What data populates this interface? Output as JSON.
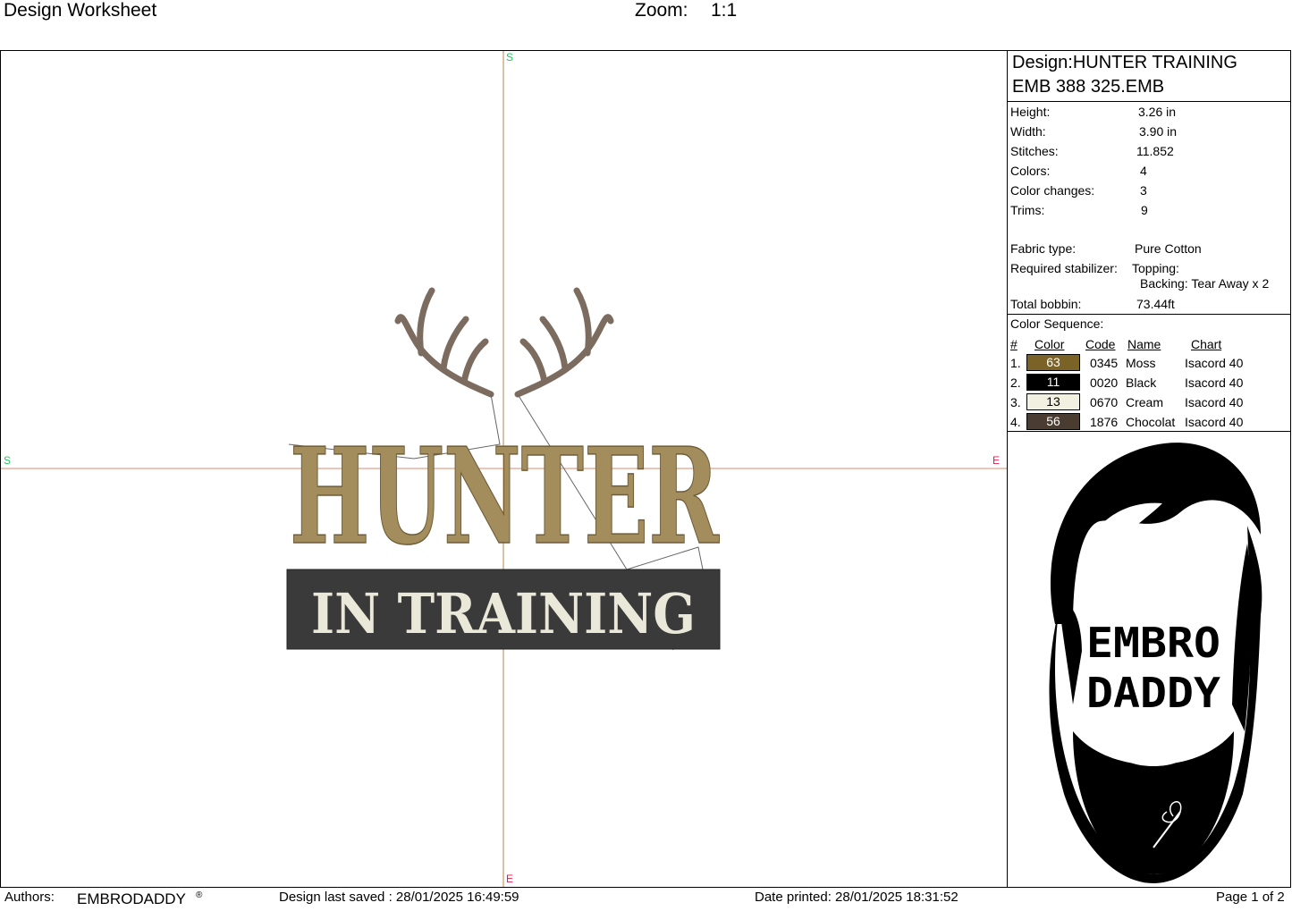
{
  "header": {
    "title": "Design Worksheet",
    "zoom_label": "Zoom:",
    "zoom_value": "1:1"
  },
  "canvas": {
    "axis_marks": {
      "top": "S",
      "bottom": "E",
      "left": "S",
      "right": "E"
    },
    "design_text": {
      "line1": "HUNTER",
      "line2": "IN TRAINING"
    },
    "colors": {
      "axis": "#b8864a",
      "marker_green": "#22c55e",
      "marker_red": "#e11d48",
      "moss": "#a38d5d",
      "antler": "#7c6c60",
      "black": "#3a3a3a",
      "cream": "#eae8d8"
    }
  },
  "info": {
    "design_name": "Design:HUNTER TRAINING",
    "file_name": "EMB 388 325.EMB",
    "rows": [
      {
        "label": "Height:",
        "value": "3.26 in"
      },
      {
        "label": "Width:",
        "value": "3.90 in"
      },
      {
        "label": "Stitches:",
        "value": "11.852"
      },
      {
        "label": "Colors:",
        "value": "4"
      },
      {
        "label": "Color changes:",
        "value": "3"
      },
      {
        "label": "Trims:",
        "value": "9"
      }
    ],
    "fabric_label": "Fabric type:",
    "fabric_value": "Pure Cotton",
    "stabilizer_label": "Required stabilizer:",
    "topping": "Topping:",
    "backing": "Backing: Tear Away x 2",
    "bobbin_label": "Total bobbin:",
    "bobbin_value": "73.44ft",
    "sequence_title": "Color Sequence:",
    "sequence_headers": {
      "num": "#",
      "color": "Color",
      "code": "Code",
      "name": "Name",
      "chart": "Chart"
    },
    "sequence": [
      {
        "num": "1.",
        "color_no": "63",
        "swatch": "#7b6328",
        "text_color": "#ffffff",
        "code": "0345",
        "name": "Moss",
        "chart": "Isacord 40"
      },
      {
        "num": "2.",
        "color_no": "11",
        "swatch": "#000000",
        "text_color": "#ffffff",
        "code": "0020",
        "name": "Black",
        "chart": "Isacord 40"
      },
      {
        "num": "3.",
        "color_no": "13",
        "swatch": "#f2f0e0",
        "text_color": "#000000",
        "code": "0670",
        "name": "Cream",
        "chart": "Isacord 40"
      },
      {
        "num": "4.",
        "color_no": "56",
        "swatch": "#4a3c31",
        "text_color": "#ffffff",
        "code": "1876",
        "name": "Chocolat",
        "chart": "Isacord 40"
      }
    ]
  },
  "logo": {
    "line1": "EMBRO",
    "line2": "DADDY"
  },
  "footer": {
    "authors_label": "Authors:",
    "authors_value": "EMBRODADDY",
    "registered": "®",
    "saved": "Design last saved : 28/01/2025 16:49:59",
    "printed": "Date printed: 28/01/2025 18:31:52",
    "page": "Page 1 of 2"
  }
}
